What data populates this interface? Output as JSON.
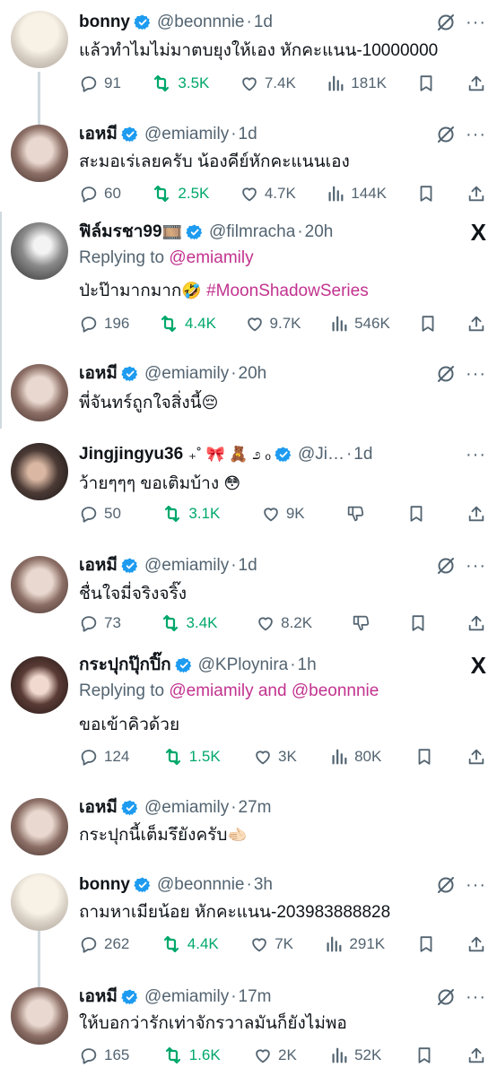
{
  "tweets": [
    {
      "name": "bonny",
      "handle": "@beonnnie",
      "time": "1d",
      "text": "แล้วทำไมไม่มาตบยุงให้เอง หักคะแนน-10000000",
      "replies": "91",
      "reposts": "3.5K",
      "likes": "7.4K",
      "views": "181K"
    },
    {
      "name": "เอหมี",
      "handle": "@emiamily",
      "time": "1d",
      "text": "สะมอเร่เลยครับ น้องคีย์หักคะแนนเอง",
      "replies": "60",
      "reposts": "2.5K",
      "likes": "4.7K",
      "views": "144K"
    },
    {
      "name": "ฟิล์มรชา99",
      "name_emoji": "🎞️",
      "handle": "@filmracha",
      "time": "20h",
      "replying_prefix": "Replying to",
      "replying_to": "@emiamily",
      "text": "ป่ะป๊ามากมาก",
      "text_emoji": "🤣",
      "hashtag": "#MoonShadowSeries",
      "replies": "196",
      "reposts": "4.4K",
      "likes": "9.7K",
      "views": "546K",
      "x_logo": "X"
    },
    {
      "name": "เอหมี",
      "handle": "@emiamily",
      "time": "20h",
      "text": "พี่จันทร์ถูกใจสิ่งนี้",
      "text_emoji": "😔"
    },
    {
      "name": "Jingjingyu36",
      "name_decor": "₊˚ 🎀 🧸 ೨ ₒ",
      "handle": "@Ji…",
      "time": "1d",
      "text": "ว้ายๆๆๆ ขอเติมบ้าง",
      "text_emoji": "😳",
      "replies": "50",
      "reposts": "3.1K",
      "likes": "9K"
    },
    {
      "name": "เอหมี",
      "handle": "@emiamily",
      "time": "1d",
      "text": "ชื่นใจมี่จริงจริ๊ง",
      "replies": "73",
      "reposts": "3.4K",
      "likes": "8.2K"
    },
    {
      "name": "กระปุกปุ๊กปิ๊ก",
      "handle": "@KPloynira",
      "time": "1h",
      "replying_prefix": "Replying to",
      "replying_to": "@emiamily and @beonnnie",
      "text": "ขอเข้าคิวด้วย",
      "replies": "124",
      "reposts": "1.5K",
      "likes": "3K",
      "views": "80K",
      "x_logo": "X"
    },
    {
      "name": "เอหมี",
      "handle": "@emiamily",
      "time": "27m",
      "text": "กระปุกนี้เต็มรึยังครับ",
      "text_emoji": "🫲🏻"
    },
    {
      "name": "bonny",
      "handle": "@beonnnie",
      "time": "3h",
      "text": "ถามหาเมียน้อย หักคะแนน-203983888828",
      "replies": "262",
      "reposts": "4.4K",
      "likes": "7K",
      "views": "291K"
    },
    {
      "name": "เอหมี",
      "handle": "@emiamily",
      "time": "17m",
      "text": "ให้บอกว่ารักเท่าจักรวาลมันก็ยังไม่พอ",
      "replies": "165",
      "reposts": "1.6K",
      "likes": "2K",
      "views": "52K"
    }
  ],
  "colors": {
    "accent": "#1d9bf0",
    "repost": "#00a86b",
    "muted": "#536471",
    "hashtag": "#c2338f"
  }
}
